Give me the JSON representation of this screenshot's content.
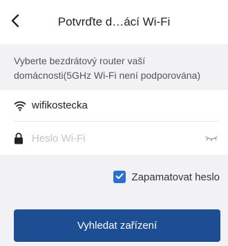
{
  "header": {
    "title": "Potvrďte d…ácí Wi-Fi",
    "back_icon": "chevron-left-icon"
  },
  "info": {
    "text": "Vyberte bezdrátový router vaší domácnosti(5GHz Wi-Fi není podporována)"
  },
  "form": {
    "ssid": "wifikostecka",
    "ssid_icon": "wifi-icon",
    "password_value": "",
    "password_placeholder": "Heslo Wi-Fi",
    "password_icon": "lock-icon",
    "eye_icon": "eye-closed-icon"
  },
  "remember": {
    "label": "Zapamatovat heslo",
    "checked": true
  },
  "action": {
    "search_label": "Vyhledat zařízení"
  },
  "colors": {
    "accent": "#1d4e93",
    "checkbox": "#2d6fcf",
    "background": "#f2f2f4"
  }
}
